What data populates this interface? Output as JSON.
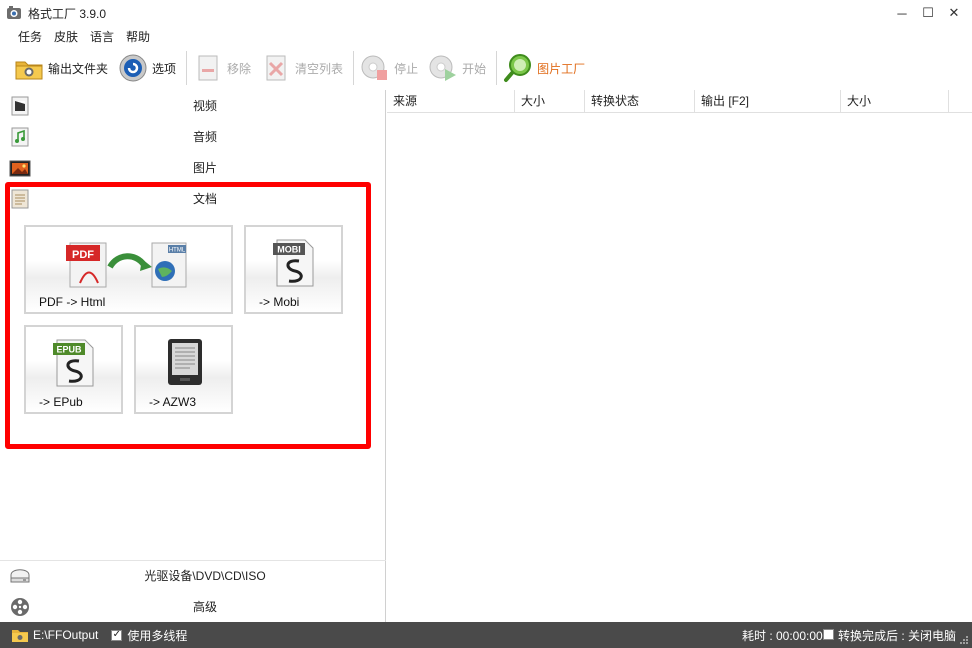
{
  "window": {
    "title": "格式工厂 3.9.0",
    "minimize": "─",
    "maximize": "☐",
    "close": "✕"
  },
  "menu": [
    "任务",
    "皮肤",
    "语言",
    "帮助"
  ],
  "toolbar": {
    "output_folder": "输出文件夹",
    "options": "选项",
    "remove": "移除",
    "clear_list": "清空列表",
    "stop": "停止",
    "start": "开始",
    "picture_factory": "图片工厂"
  },
  "categories": {
    "video": "视频",
    "audio": "音频",
    "picture": "图片",
    "document": "文档",
    "optical": "光驱设备\\DVD\\CD\\ISO",
    "advanced": "高级"
  },
  "document_tiles": {
    "pdf_html": "PDF -> Html",
    "mobi": "-> Mobi",
    "epub": "-> EPub",
    "azw3": "-> AZW3"
  },
  "tile_icon_text": {
    "pdf": "PDF",
    "html": "HTML",
    "mobi": "MOBI",
    "epub": "EPUB"
  },
  "columns": [
    "来源",
    "大小",
    "转换状态",
    "输出 [F2]",
    "大小"
  ],
  "status": {
    "output_path": "E:\\FFOutput",
    "multithread_checked": "✓",
    "multithread": "使用多线程",
    "elapsed": "耗时 : 00:00:00",
    "after_done": "转换完成后 : 关闭电脑"
  },
  "colors": {
    "highlight": "#ff0000",
    "statusbar": "#4a4a4a",
    "accent_label": "#e06c1a"
  }
}
